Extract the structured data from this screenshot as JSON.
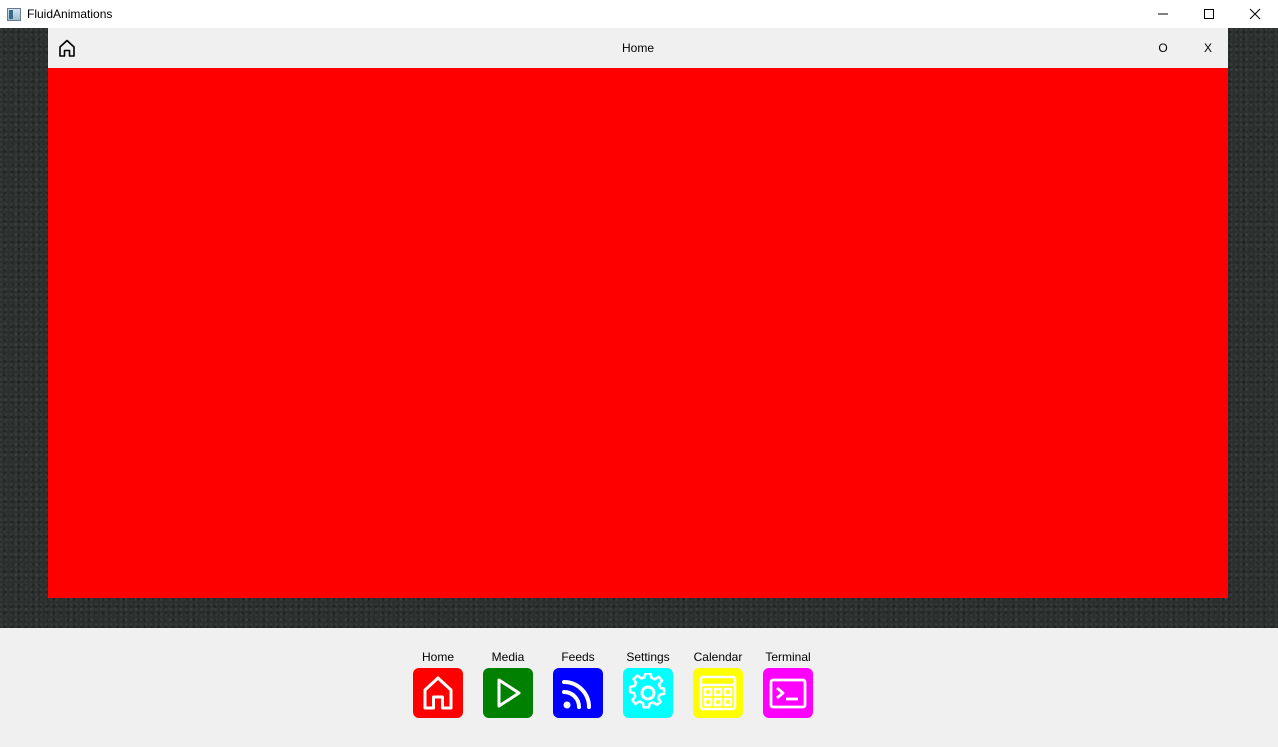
{
  "window": {
    "title": "FluidAnimations",
    "controls": {
      "minimize": "minimize-icon",
      "maximize": "maximize-icon",
      "close": "close-icon"
    }
  },
  "panel": {
    "title": "Home",
    "o_label": "O",
    "x_label": "X",
    "content_color": "#ff0000"
  },
  "dock": {
    "items": [
      {
        "label": "Home",
        "icon": "home-icon",
        "color": "#ff0000"
      },
      {
        "label": "Media",
        "icon": "play-icon",
        "color": "#008000"
      },
      {
        "label": "Feeds",
        "icon": "rss-icon",
        "color": "#0000ff"
      },
      {
        "label": "Settings",
        "icon": "gear-icon",
        "color": "#00ffff"
      },
      {
        "label": "Calendar",
        "icon": "calendar-icon",
        "color": "#ffff00"
      },
      {
        "label": "Terminal",
        "icon": "terminal-icon",
        "color": "#ff00ff"
      }
    ]
  }
}
